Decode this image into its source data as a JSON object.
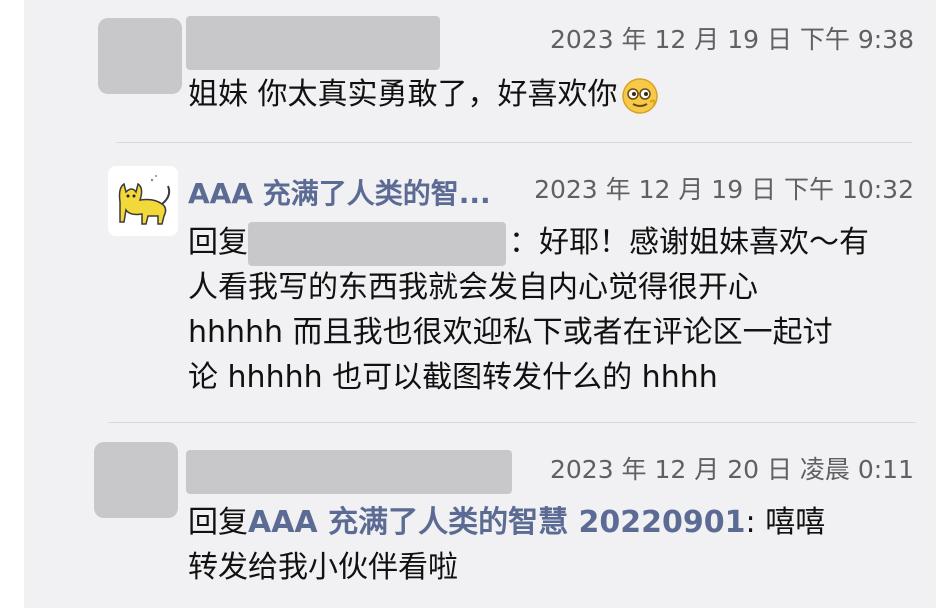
{
  "comments": [
    {
      "timestamp": "2023 年 12 月 19 日 下午 9:38",
      "text": "姐妹 你太真实勇敢了，好喜欢你",
      "emoji": "nerd-face-emoji"
    },
    {
      "username": "AAA 充满了人类的智...",
      "timestamp": "2023 年 12 月 19 日 下午 10:32",
      "reply_prefix": "回复",
      "lines": [
        "：好耶！感谢姐妹喜欢～有",
        "人看我写的东西我就会发自内心觉得很开心",
        "hhhhh 而且我也很欢迎私下或者在评论区一起讨",
        "论 hhhhh 也可以截图转发什么的 hhhh"
      ],
      "avatar": "yellow-cat-icon"
    },
    {
      "timestamp": "2023 年 12 月 20 日 凌晨 0:11",
      "reply_prefix": "回复",
      "reply_to": "AAA 充满了人类的智慧 20220901",
      "line1_suffix": ": 嘻嘻",
      "line2": "转发给我小伙伴看啦"
    }
  ],
  "colors": {
    "panel": "#f1f1f3",
    "link": "#5b6b94",
    "redacted": "#c8c8ca",
    "timestamp": "#5f5f64"
  }
}
